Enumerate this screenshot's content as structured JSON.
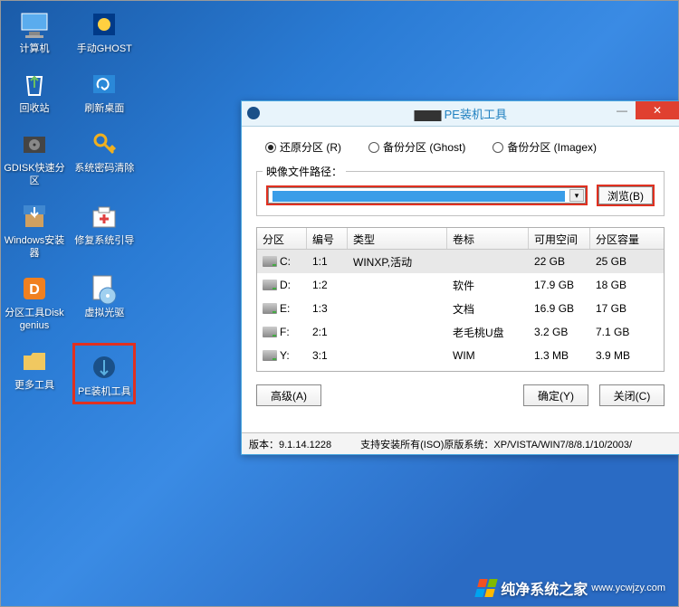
{
  "desktop_icons": [
    {
      "id": "computer",
      "label": "计算机"
    },
    {
      "id": "ghost",
      "label": "手动GHOST"
    },
    {
      "id": "recycle",
      "label": "回收站"
    },
    {
      "id": "refresh",
      "label": "刷新桌面"
    },
    {
      "id": "gdisk",
      "label": "GDISK快速分区"
    },
    {
      "id": "pwclear",
      "label": "系统密码清除"
    },
    {
      "id": "wininst",
      "label": "Windows安装器"
    },
    {
      "id": "bootfix",
      "label": "修复系统引导"
    },
    {
      "id": "diskgenius",
      "label": "分区工具Diskgenius"
    },
    {
      "id": "vcd",
      "label": "虚拟光驱"
    },
    {
      "id": "moretools",
      "label": "更多工具"
    },
    {
      "id": "petool",
      "label": "PE装机工具"
    }
  ],
  "dialog": {
    "title": "PE装机工具",
    "radios": [
      {
        "label": "还原分区 (R)",
        "sel": true
      },
      {
        "label": "备份分区 (Ghost)",
        "sel": false
      },
      {
        "label": "备份分区 (Imagex)",
        "sel": false
      }
    ],
    "image_path_label": "映像文件路径：",
    "browse_label": "浏览(B)",
    "table": {
      "headers": [
        "分区",
        "编号",
        "类型",
        "卷标",
        "可用空间",
        "分区容量"
      ],
      "rows": [
        {
          "part": "C:",
          "num": "1:1",
          "type": "WINXP,活动",
          "vol": "",
          "free": "22 GB",
          "cap": "25 GB",
          "sel": true
        },
        {
          "part": "D:",
          "num": "1:2",
          "type": "",
          "vol": "软件",
          "free": "17.9 GB",
          "cap": "18 GB"
        },
        {
          "part": "E:",
          "num": "1:3",
          "type": "",
          "vol": "文档",
          "free": "16.9 GB",
          "cap": "17 GB"
        },
        {
          "part": "F:",
          "num": "2:1",
          "type": "",
          "vol": "老毛桃U盘",
          "free": "3.2 GB",
          "cap": "7.1 GB"
        },
        {
          "part": "Y:",
          "num": "3:1",
          "type": "",
          "vol": "WIM",
          "free": "1.3 MB",
          "cap": "3.9 MB"
        }
      ]
    },
    "buttons": {
      "adv": "高级(A)",
      "ok": "确定(Y)",
      "close": "关闭(C)"
    },
    "status": {
      "version": "版本：9.1.14.1228",
      "note": "支持安装所有(ISO)原版系统：XP/VISTA/WIN7/8/8.1/10/2003/"
    }
  },
  "watermark": {
    "text": "纯净系统之家",
    "url": "www.ycwjzy.com"
  }
}
